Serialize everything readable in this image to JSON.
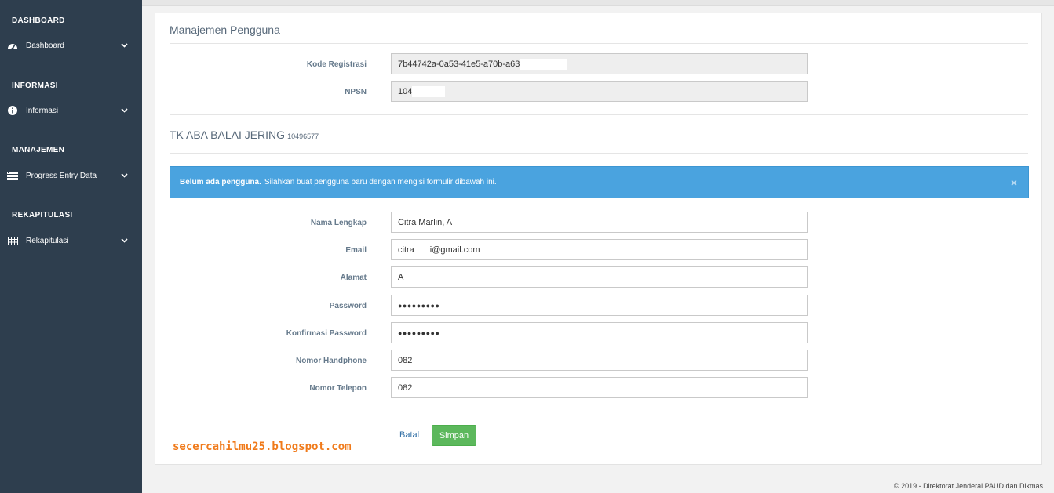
{
  "sidebar": {
    "sections": [
      {
        "title": "DASHBOARD",
        "item": "Dashboard",
        "icon": "dashboard-gauge-icon"
      },
      {
        "title": "INFORMASI",
        "item": "Informasi",
        "icon": "info-circle-icon"
      },
      {
        "title": "MANAJEMEN",
        "item": "Progress Entry Data",
        "icon": "server-list-icon"
      },
      {
        "title": "REKAPITULASI",
        "item": "Rekapitulasi",
        "icon": "table-grid-icon"
      }
    ]
  },
  "panel": {
    "title": "Manajemen Pengguna",
    "registration": {
      "code_label": "Kode Registrasi",
      "code_value": "7b44742a-0a53-41e5-a70b-a63",
      "npsn_label": "NPSN",
      "npsn_value": "104"
    },
    "school": {
      "name": "TK ABA BALAI JERING",
      "npsn": "10496577"
    },
    "alert": {
      "strong": "Belum ada pengguna.",
      "message": "Silahkan buat pengguna baru dengan mengisi formulir dibawah ini.",
      "close": "×"
    },
    "form": {
      "nama_label": "Nama Lengkap",
      "nama_value": "Citra Marlin, A",
      "email_label": "Email",
      "email_prefix": "citra",
      "email_suffix": "i@gmail.com",
      "alamat_label": "Alamat",
      "alamat_value": "A",
      "password_label": "Password",
      "password_value": "●●●●●●●●●",
      "konfirmasi_label": "Konfirmasi Password",
      "konfirmasi_value": "●●●●●●●●●",
      "handphone_label": "Nomor Handphone",
      "handphone_value": "082",
      "telepon_label": "Nomor Telepon",
      "telepon_value": "082"
    },
    "actions": {
      "cancel": "Batal",
      "save": "Simpan"
    }
  },
  "watermark": "secercahilmu25.blogspot.com",
  "footer": "©   2019 - Direktorat Jenderal PAUD dan Dikmas"
}
